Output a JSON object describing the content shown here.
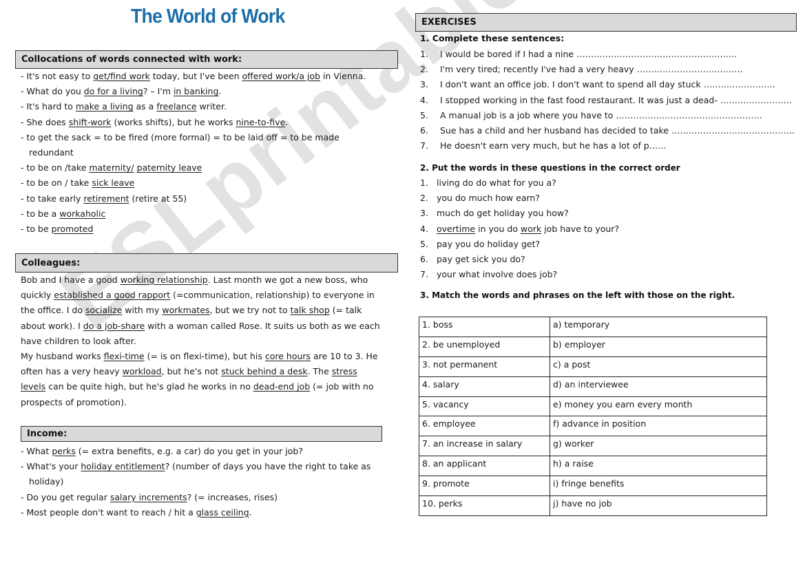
{
  "title": "The World of Work",
  "watermark": "ESLprintables.com",
  "colors": {
    "title": "#1b6ea8",
    "header_bg": "#d9d9d9"
  },
  "collocations": {
    "header": "Collocations of words connected with work:",
    "lines": [
      [
        {
          "t": "- It's not easy to "
        },
        {
          "t": "get/find work",
          "u": true
        },
        {
          "t": " today, but I've been "
        },
        {
          "t": "offered work/a job",
          "u": true
        },
        {
          "t": " in Vienna."
        }
      ],
      [
        {
          "t": "- What do you "
        },
        {
          "t": "do for a living",
          "u": true
        },
        {
          "t": "? – I'm "
        },
        {
          "t": "in banking",
          "u": true
        },
        {
          "t": "."
        }
      ],
      [
        {
          "t": "- It's hard to "
        },
        {
          "t": "make a living",
          "u": true
        },
        {
          "t": " as a "
        },
        {
          "t": "freelance",
          "u": true
        },
        {
          "t": " writer."
        }
      ],
      [
        {
          "t": "- She does "
        },
        {
          "t": "shift-work",
          "u": true
        },
        {
          "t": " (works shifts), but he works "
        },
        {
          "t": "nine-to-five",
          "u": true
        },
        {
          "t": "."
        }
      ],
      [
        {
          "t": "- to get the sack = to be fired (more formal) = to be laid off = to be made"
        }
      ],
      [
        {
          "t": "redundant",
          "indent": true
        }
      ],
      [
        {
          "t": "- to be on /take "
        },
        {
          "t": "maternity/",
          "u": true
        },
        {
          "t": " "
        },
        {
          "t": "paternity leave",
          "u": true
        }
      ],
      [
        {
          "t": "- to be on / take "
        },
        {
          "t": "sick leave",
          "u": true
        }
      ],
      [
        {
          "t": "- to take early "
        },
        {
          "t": "retirement",
          "u": true
        },
        {
          "t": " (retire at 55)"
        }
      ],
      [
        {
          "t": "- to be a "
        },
        {
          "t": "workaholic",
          "u": true
        }
      ],
      [
        {
          "t": "- to be "
        },
        {
          "t": "promoted",
          "u": true
        }
      ]
    ]
  },
  "colleagues": {
    "header": "Colleagues:",
    "lines": [
      [
        {
          "t": "Bob and I have a good "
        },
        {
          "t": "working relationship",
          "u": true
        },
        {
          "t": ". Last month we got a new boss, who"
        }
      ],
      [
        {
          "t": "quickly "
        },
        {
          "t": "established a good rapport",
          "u": true
        },
        {
          "t": " (=communication, relationship) to everyone in"
        }
      ],
      [
        {
          "t": "the office. I do "
        },
        {
          "t": "socialize",
          "u": true
        },
        {
          "t": " with my "
        },
        {
          "t": "workmates",
          "u": true
        },
        {
          "t": ", but we try not to "
        },
        {
          "t": "talk shop",
          "u": true
        },
        {
          "t": " (= talk"
        }
      ],
      [
        {
          "t": "about work). I "
        },
        {
          "t": "do a job-share",
          "u": true
        },
        {
          "t": " with a woman called Rose. It suits us both as we each"
        }
      ],
      [
        {
          "t": "have children to look after."
        }
      ],
      [
        {
          "t": "My husband works "
        },
        {
          "t": "flexi-time",
          "u": true
        },
        {
          "t": " (= is on flexi-time), but his "
        },
        {
          "t": "core hours",
          "u": true
        },
        {
          "t": " are 10 to 3. He"
        }
      ],
      [
        {
          "t": "often has a very heavy "
        },
        {
          "t": "workload",
          "u": true
        },
        {
          "t": ", but he's not "
        },
        {
          "t": "stuck behind a desk",
          "u": true
        },
        {
          "t": ". The "
        },
        {
          "t": "stress",
          "u": true
        }
      ],
      [
        {
          "t": "levels",
          "u": true
        },
        {
          "t": " can be quite high, but he's glad he works in no "
        },
        {
          "t": "dead-end job",
          "u": true
        },
        {
          "t": " (= job with no"
        }
      ],
      [
        {
          "t": "prospects of promotion)."
        }
      ]
    ]
  },
  "income": {
    "header": "Income:",
    "lines": [
      [
        {
          "t": "- What "
        },
        {
          "t": "perks",
          "u": true
        },
        {
          "t": " (= extra benefits, e.g. a car) do you get in your job?"
        }
      ],
      [
        {
          "t": "- What's your "
        },
        {
          "t": "holiday entitlement",
          "u": true
        },
        {
          "t": "? (number of days you have the right to take as"
        }
      ],
      [
        {
          "t": "holiday)",
          "indent": true
        }
      ],
      [
        {
          "t": "- Do you get regular "
        },
        {
          "t": "salary increments",
          "u": true
        },
        {
          "t": "? (= increases, rises)"
        }
      ],
      [
        {
          "t": "- Most people don't want to reach /  hit a "
        },
        {
          "t": "glass ceiling",
          "u": true
        },
        {
          "t": "."
        }
      ]
    ]
  },
  "exercises": {
    "header": "EXERCISES",
    "ex1": {
      "heading": "1. Complete these sentences:",
      "items": [
        {
          "num": "1.",
          "text": "I would be bored if I had a nine ……………………………………………….."
        },
        {
          "num": "2.",
          "text": "I'm very tired; recently I've had a very heavy ………………………………."
        },
        {
          "num": "3.",
          "text": "I don't want an office job. I don't want to spend all day stuck ……………………."
        },
        {
          "num": "4.",
          "text": "I stopped working in the fast food restaurant. It was just a dead- ……………………."
        },
        {
          "num": "5.",
          "text": "A manual job is a job where you have to ……………………………………………"
        },
        {
          "num": "6.",
          "text": "Sue has a child and her husband has decided to take ……………………………………."
        },
        {
          "num": "7.",
          "text": "He doesn't earn very much, but he has a lot of p……"
        }
      ]
    },
    "ex2": {
      "heading": "2. Put the words in these questions in the correct order",
      "items": [
        [
          {
            "t": "1."
          },
          {
            "t": "living do do what for you a?"
          }
        ],
        [
          {
            "t": "2."
          },
          {
            "t": "you do much how earn?"
          }
        ],
        [
          {
            "t": "3."
          },
          {
            "t": "much do get holiday you how?"
          }
        ],
        [
          {
            "t": "4."
          },
          {
            "t": "overtime",
            "u": true
          },
          {
            "t": " in you do "
          },
          {
            "t": "work",
            "u": true
          },
          {
            "t": " job have to your?"
          }
        ],
        [
          {
            "t": "5."
          },
          {
            "t": "pay you do holiday get?"
          }
        ],
        [
          {
            "t": "6."
          },
          {
            "t": "pay get sick you do?"
          }
        ],
        [
          {
            "t": "7."
          },
          {
            "t": "your what involve does job?"
          }
        ]
      ]
    },
    "ex3": {
      "heading": "3. Match the words and phrases on the left with those on the right.",
      "rows": [
        {
          "left": "1.   boss",
          "right": "a)  temporary"
        },
        {
          "left": "2.   be unemployed",
          "right": "b)  employer"
        },
        {
          "left": "3.   not permanent",
          "right": "c)  a post"
        },
        {
          "left": "4.   salary",
          "right": "d)  an interviewee"
        },
        {
          "left": "5.   vacancy",
          "right": "e)  money you earn every month"
        },
        {
          "left": "6.   employee",
          "right": "f)  advance in position"
        },
        {
          "left": "7.   an increase in salary",
          "right": "g)  worker"
        },
        {
          "left": "8.   an applicant",
          "right": "h)  a raise"
        },
        {
          "left": "9.   promote",
          "right": "i)  fringe benefits"
        },
        {
          "left": "10.  perks",
          "right": "j)  have no job"
        }
      ]
    }
  }
}
